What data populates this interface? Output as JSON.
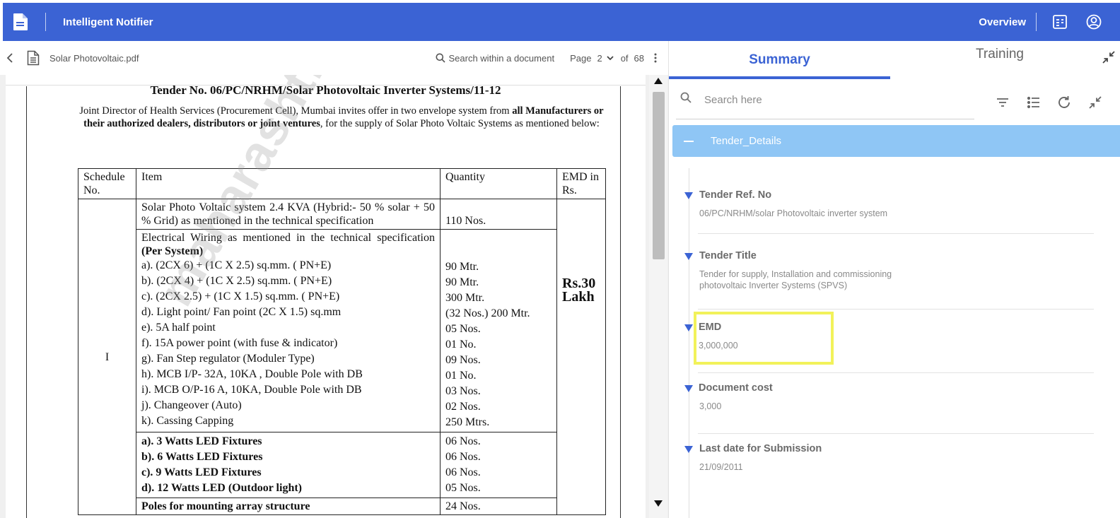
{
  "header": {
    "app_title": "Intelligent Notifier",
    "overview_label": "Overview",
    "colors": {
      "brand": "#3b63d4"
    }
  },
  "toolbar": {
    "file_name": "Solar Photovoltaic.pdf",
    "search_placeholder": "Search within a document",
    "page_label": "Page",
    "current_page": "2",
    "of_label": "of",
    "total_pages": "68"
  },
  "document": {
    "title": "Tender No. 06/PC/NRHM/Solar Photovoltaic Inverter Systems/11-12",
    "intro_part1": "Joint Director of Health Services (Procurement Cell), Mumbai invites offer in two envelope system from ",
    "intro_bold": "all Manufacturers or their authorized dealers, distributors or joint ventures",
    "intro_part2": ", for the supply of Solar Photo Voltaic Systems as mentioned below:",
    "watermark": "maharashtra.gov.in",
    "table": {
      "headers": [
        "Schedule No.",
        "Item",
        "Quantity",
        "EMD in Rs."
      ],
      "schedule": "I",
      "emd": "Rs.30 Lakh",
      "row1_item": "Solar Photo Voltaic system 2.4 KVA (Hybrid:- 50 % solar + 50 % Grid) as mentioned in the technical specification",
      "row1_qty": "110     Nos.",
      "row2_intro": "Electrical Wiring as mentioned in the technical specification ",
      "row2_intro_bold": "(Per System)",
      "row2_items": [
        "a).  (2CX 6) + (1C X 2.5)  sq.mm.  ( PN+E)",
        "b).  (2CX 4) + (1C X 2.5)  sq.mm.  ( PN+E)",
        "c).  (2CX 2.5) + (1C X 1.5)  sq.mm. ( PN+E)",
        "d). Light point/ Fan point (2C X 1.5)  sq.mm",
        "e).  5A half point",
        "f).  15A power point (with fuse & indicator)",
        "g). Fan Step regulator (Moduler Type)",
        "h). MCB  I/P- 32A, 10KA , Double Pole  with DB",
        "i).  MCB O/P-16 A, 10KA, Double Pole with DB",
        "j).  Changeover (Auto)",
        "k). Cassing Capping"
      ],
      "row2_qty": [
        "90   Mtr.",
        "90   Mtr.",
        "300 Mtr.",
        "(32 Nos.) 200 Mtr.",
        "05  Nos.",
        "01  No.",
        "09  Nos.",
        "01  No.",
        "03  Nos.",
        "02 Nos.",
        "250 Mtrs."
      ],
      "row3_items": [
        "a).  3 Watts LED Fixtures",
        "b).  6 Watts LED Fixtures",
        "c).  9 Watts LED Fixtures",
        "d). 12 Watts LED (Outdoor light)"
      ],
      "row3_qty": [
        "06  Nos.",
        "06  Nos.",
        "06  Nos.",
        "05  Nos."
      ],
      "row4_item": "Poles for mounting array structure",
      "row4_qty": "24 Nos."
    }
  },
  "panel": {
    "tabs": [
      "Summary",
      "Training"
    ],
    "search_placeholder": "Search here",
    "section_title": "Tender_Details",
    "fields": [
      {
        "label": "Tender Ref. No",
        "value": "06/PC/NRHM/solar Photovoltaic inverter system"
      },
      {
        "label": "Tender Title",
        "value": "Tender for supply, Installation and commissioning photovoltaic Inverter Systems (SPVS)"
      },
      {
        "label": "EMD",
        "value": "3,000,000"
      },
      {
        "label": "Document cost",
        "value": "3,000"
      },
      {
        "label": "Last date for Submission",
        "value": "21/09/2011"
      }
    ],
    "colors": {
      "section_header": "#8fc6f5",
      "highlight": "#f2f25a"
    }
  }
}
